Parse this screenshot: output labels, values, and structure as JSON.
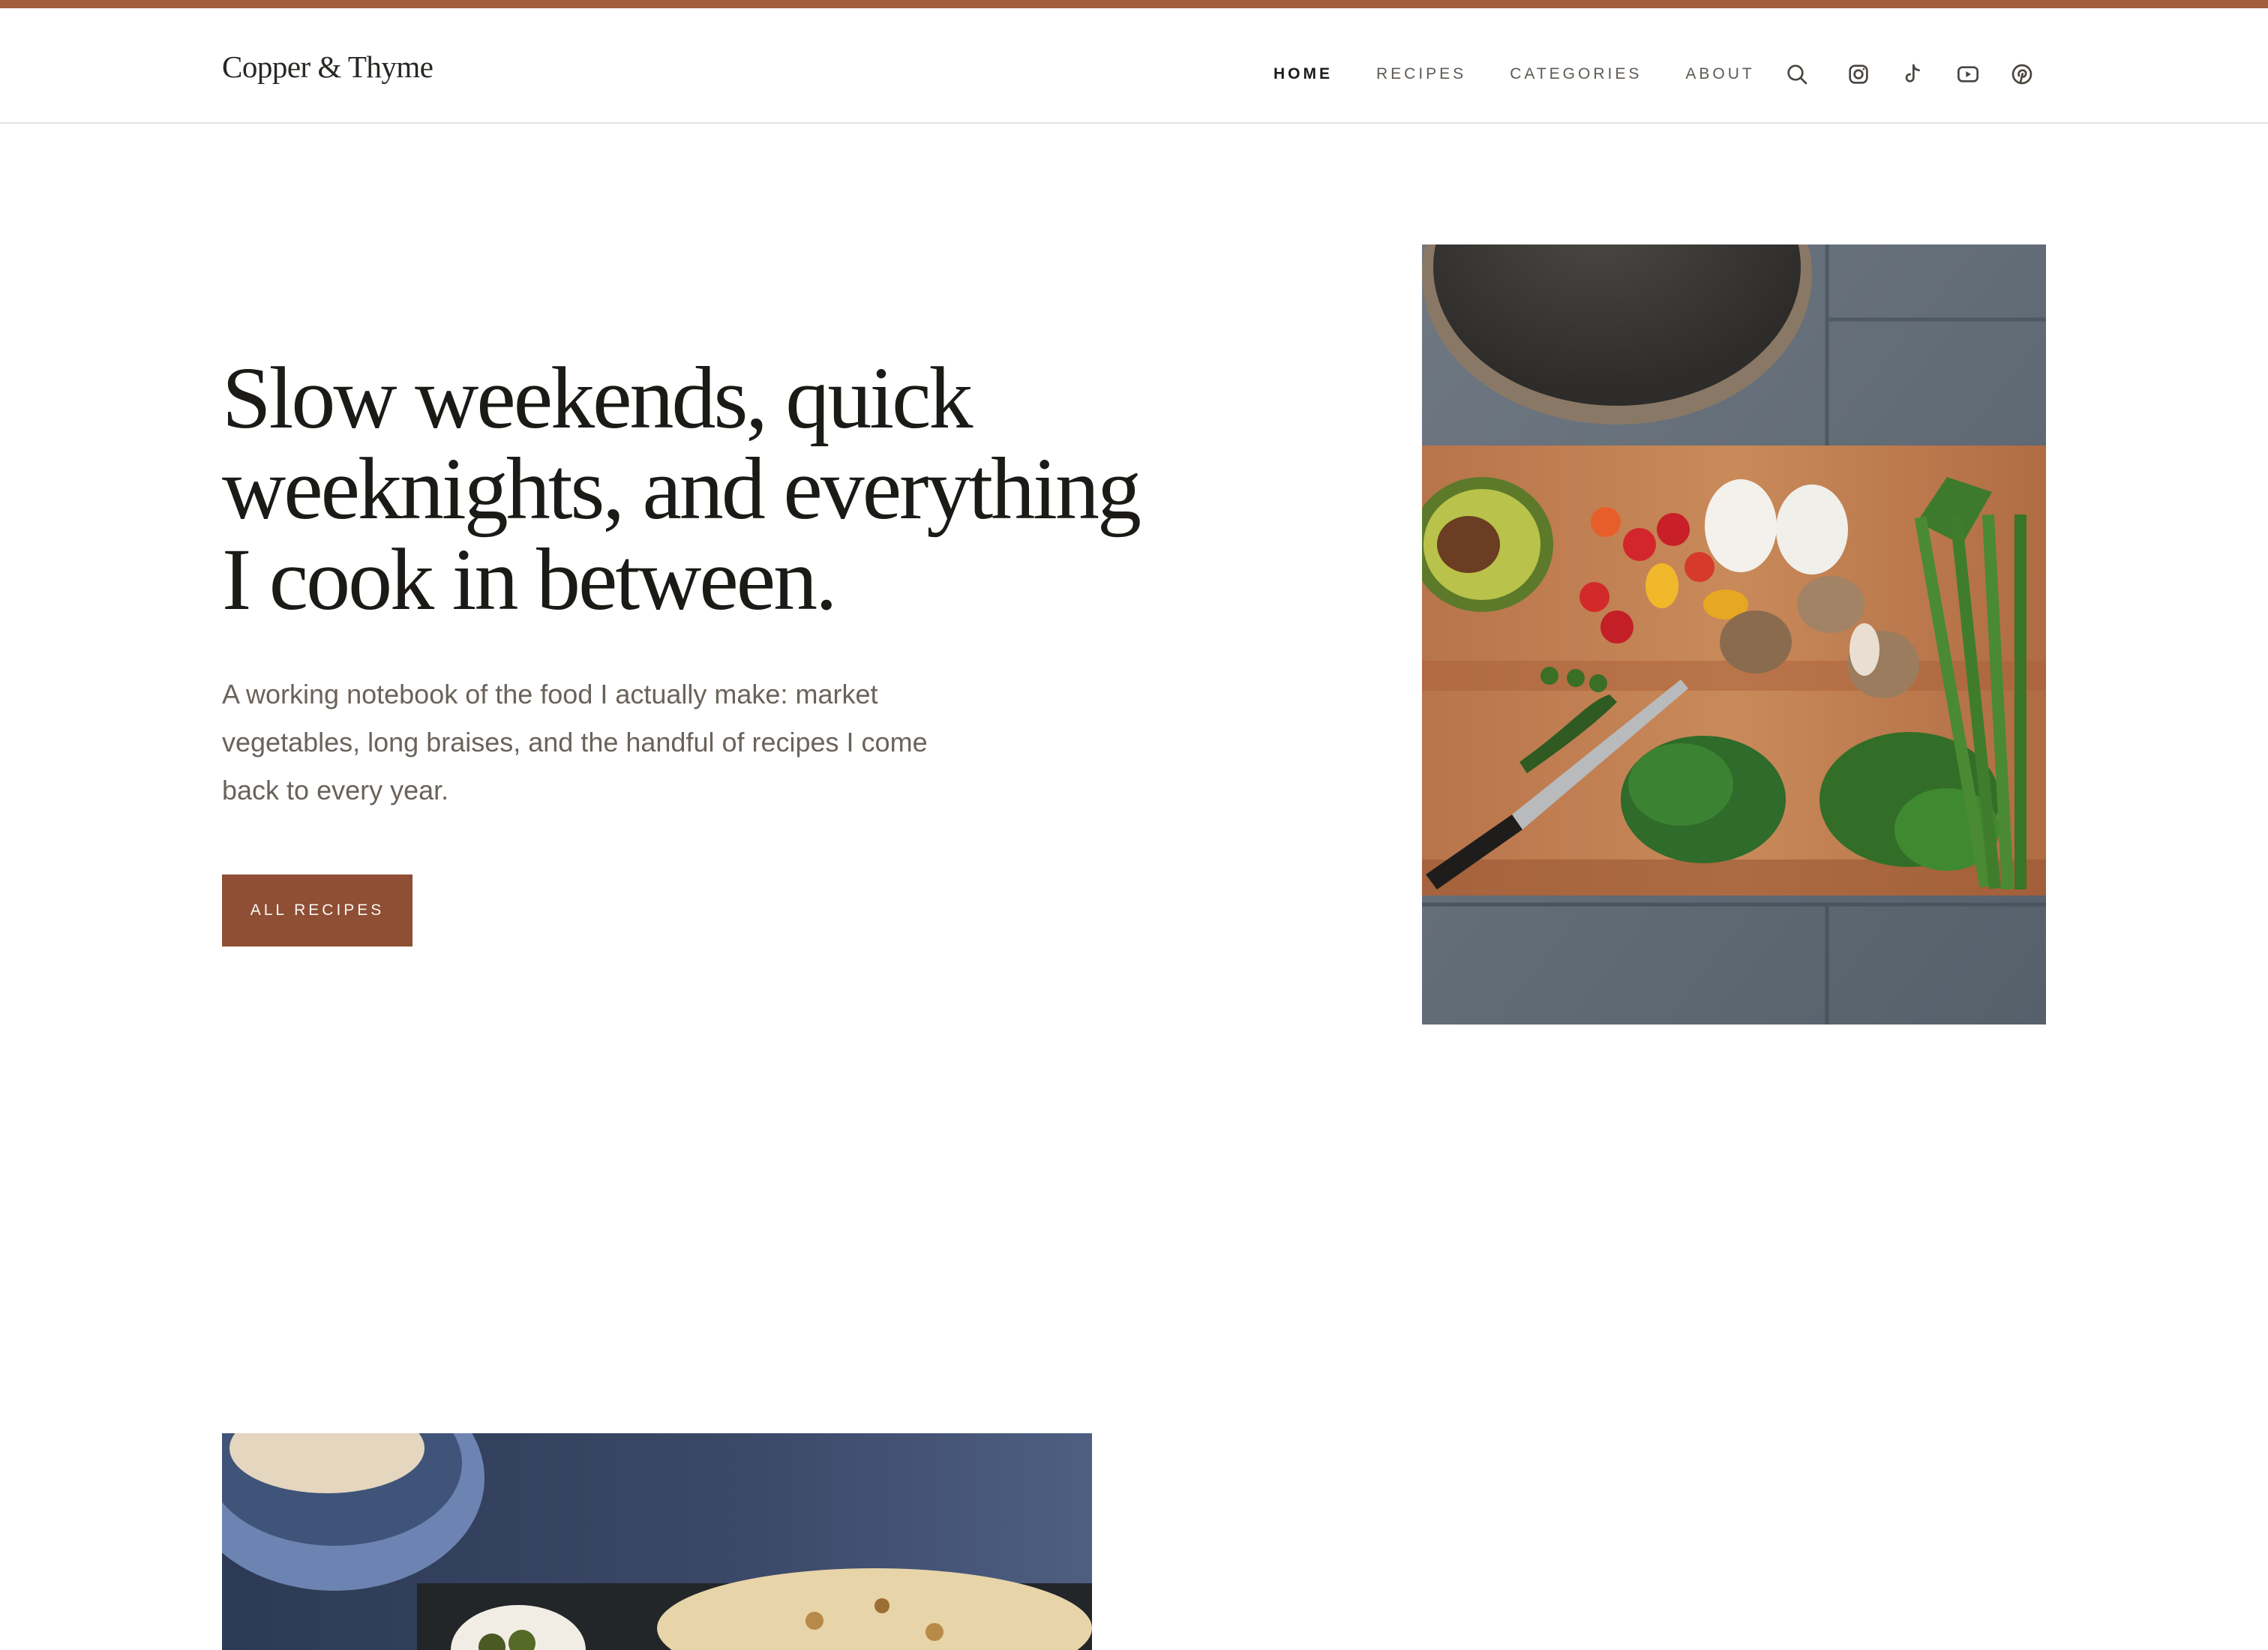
{
  "brand": {
    "name": "Copper & Thyme",
    "accent_color": "#a35d3f",
    "button_color": "#8e4f35"
  },
  "nav": {
    "links": [
      {
        "label": "HOME",
        "active": true
      },
      {
        "label": "RECIPES",
        "active": false
      },
      {
        "label": "CATEGORIES",
        "active": false
      },
      {
        "label": "ABOUT",
        "active": false
      }
    ],
    "icons": [
      "search-icon",
      "instagram-icon",
      "tiktok-icon",
      "youtube-icon",
      "pinterest-icon"
    ]
  },
  "hero": {
    "title_lines": [
      "Slow weekends, quick",
      "weeknights, and everything",
      "I cook in between."
    ],
    "subtitle_lines": [
      "A working notebook of the food I actually make: market",
      "vegetables, long braises, and the handful of recipes I come",
      "back to every year."
    ],
    "cta_label": "ALL RECIPES",
    "image": "cutting-board-vegetables-photo"
  },
  "featured": {
    "image": "flatbread-dish-photo"
  }
}
